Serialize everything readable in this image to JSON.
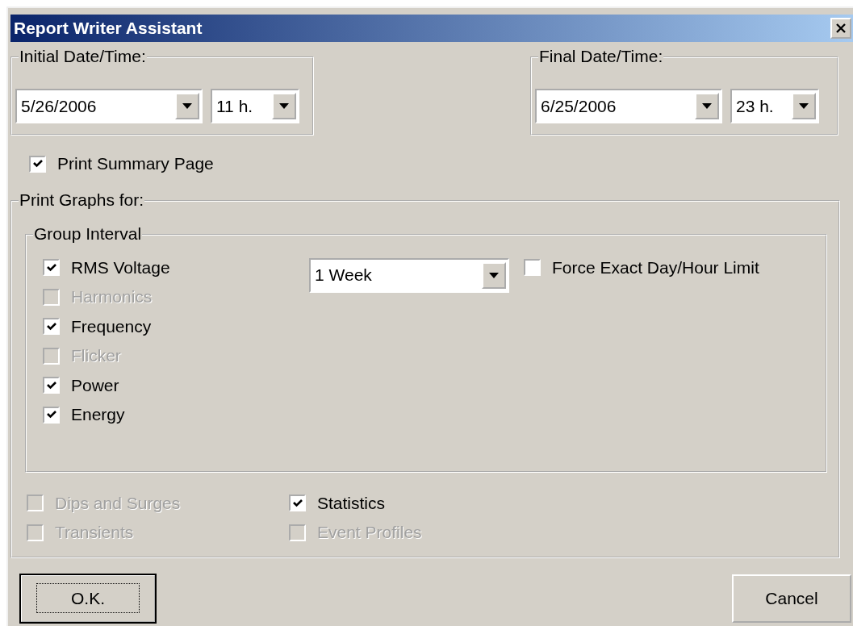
{
  "window": {
    "title": "Report Writer Assistant"
  },
  "initial": {
    "label": "Initial Date/Time:",
    "date": "5/26/2006",
    "hour": "11 h."
  },
  "final": {
    "label": "Final Date/Time:",
    "date": "6/25/2006",
    "hour": "23 h."
  },
  "summary": {
    "label": "Print Summary Page",
    "checked": true,
    "disabled": false
  },
  "graphs": {
    "label": "Print Graphs for:",
    "group_interval": {
      "label": "Group Interval",
      "interval": "1 Week",
      "force_exact": {
        "label": "Force Exact Day/Hour Limit",
        "checked": false,
        "disabled": false
      },
      "items": [
        {
          "label": "RMS Voltage",
          "checked": true,
          "disabled": false
        },
        {
          "label": "Harmonics",
          "checked": false,
          "disabled": true
        },
        {
          "label": "Frequency",
          "checked": true,
          "disabled": false
        },
        {
          "label": "Flicker",
          "checked": false,
          "disabled": true
        },
        {
          "label": "Power",
          "checked": true,
          "disabled": false
        },
        {
          "label": "Energy",
          "checked": true,
          "disabled": false
        }
      ]
    },
    "items": [
      {
        "label": "Dips and Surges",
        "checked": false,
        "disabled": true
      },
      {
        "label": "Statistics",
        "checked": true,
        "disabled": false
      },
      {
        "label": "Transients",
        "checked": false,
        "disabled": true
      },
      {
        "label": "Event Profiles",
        "checked": false,
        "disabled": true
      }
    ]
  },
  "buttons": [
    {
      "label": "O.K.",
      "default": true
    },
    {
      "label": "Cancel",
      "default": false
    }
  ]
}
